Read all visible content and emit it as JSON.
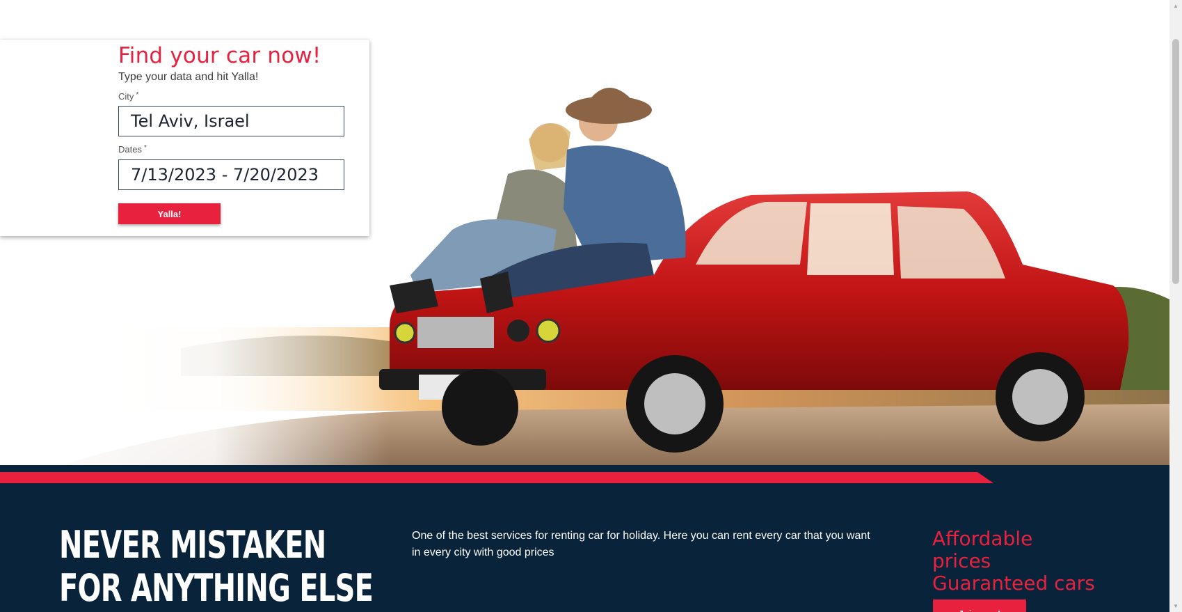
{
  "search_form": {
    "title": "Find your car now!",
    "subtitle": "Type your data and hit Yalla!",
    "city_label": "City",
    "city_value": "Tel Aviv, Israel",
    "dates_label": "Dates",
    "dates_value": "7/13/2023 - 7/20/2023",
    "required_marker": "*",
    "submit_label": "Yalla!"
  },
  "info_section": {
    "headline_line1": "NEVER MISTAKEN",
    "headline_line2": "FOR ANYTHING ELSE",
    "description": "One of the best services for renting car for holiday. Here you can rent every car that you want in every city with good prices",
    "promo_line1": "Affordable",
    "promo_line2": "prices",
    "promo_line3": "Guaranteed cars",
    "join_label": "Join now!"
  },
  "scrollbar": {
    "up_arrow": "▲",
    "down_arrow": "▼"
  },
  "colors": {
    "accent": "#e8213f",
    "navy": "#08233a",
    "white": "#ffffff"
  },
  "hero_image": {
    "icon": "couple-on-red-car-photo"
  }
}
